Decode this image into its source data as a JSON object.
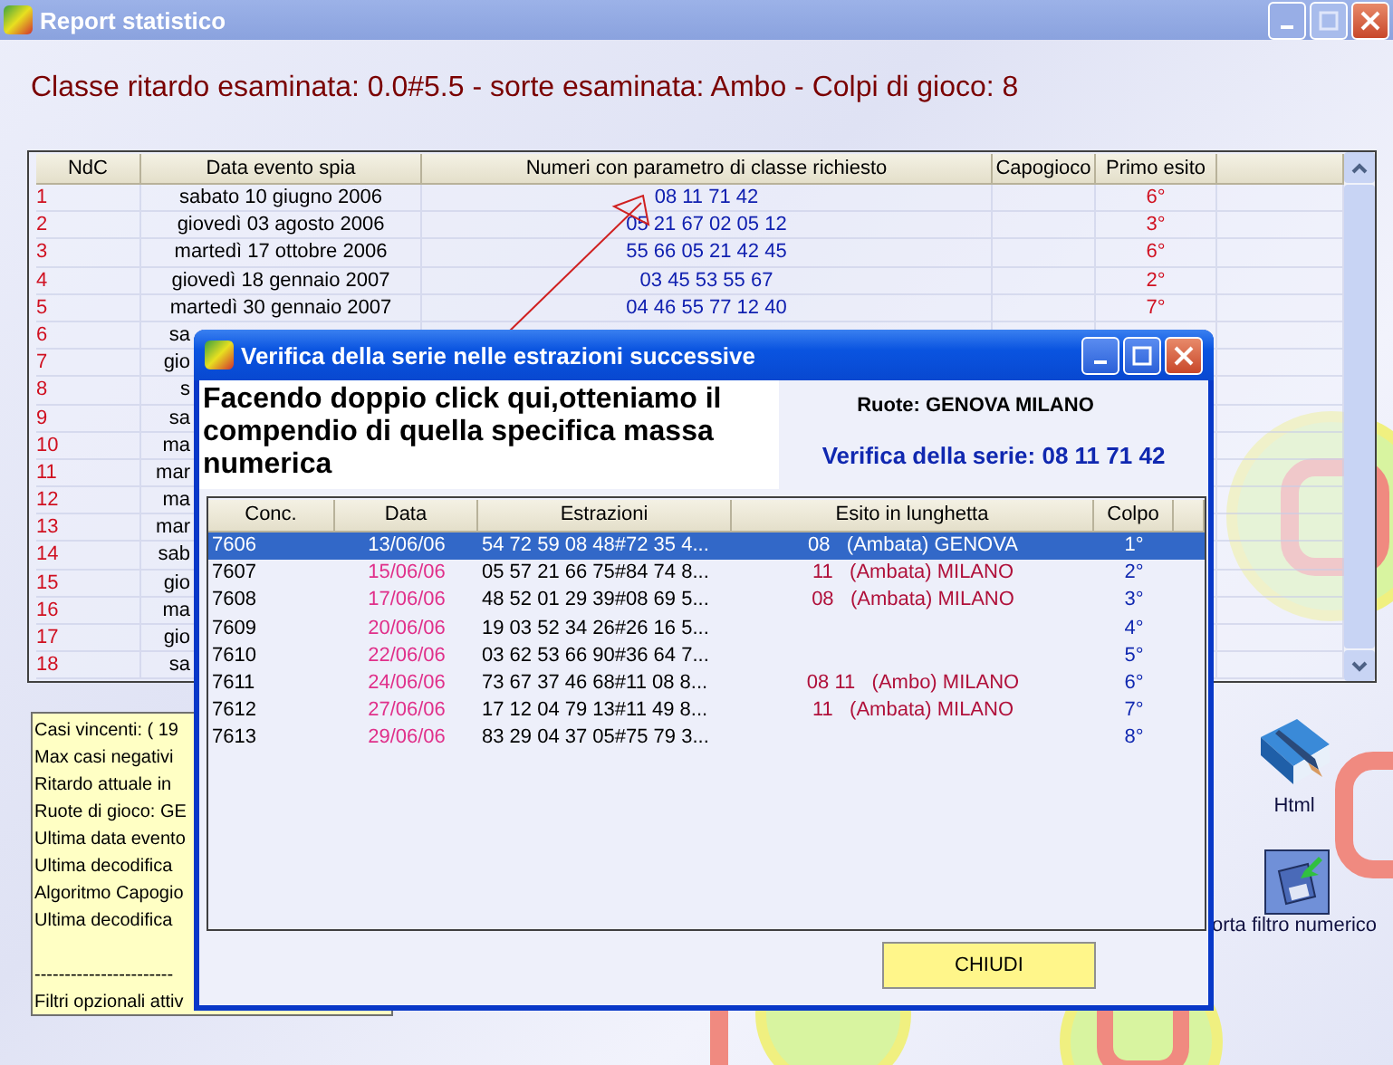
{
  "window": {
    "title": "Report statistico"
  },
  "heading": "Classe ritardo esaminata: 0.0#5.5 - sorte esaminata: Ambo - Colpi di gioco: 8",
  "report_table": {
    "columns": [
      "NdC",
      "Data evento spia",
      "Numeri con parametro di classe richiesto",
      "Capogioco",
      "Primo esito"
    ],
    "rows": [
      {
        "ndc": "1",
        "date": "sabato 10 giugno 2006",
        "numbers": "08 11 71 42",
        "primo_esito": "6°"
      },
      {
        "ndc": "2",
        "date": "giovedì 03 agosto 2006",
        "numbers": "05 21 67 02 05 12",
        "primo_esito": "3°"
      },
      {
        "ndc": "3",
        "date": "martedì 17 ottobre 2006",
        "numbers": "55 66 05 21 42 45",
        "primo_esito": "6°"
      },
      {
        "ndc": "4",
        "date": "giovedì 18 gennaio 2007",
        "numbers": "03 45 53 55 67",
        "primo_esito": "2°"
      },
      {
        "ndc": "5",
        "date": "martedì 30 gennaio 2007",
        "numbers": "04 46 55 77 12 40",
        "primo_esito": "7°"
      },
      {
        "ndc": "6",
        "date": "sa"
      },
      {
        "ndc": "7",
        "date": "gio"
      },
      {
        "ndc": "8",
        "date": "s"
      },
      {
        "ndc": "9",
        "date": "sa"
      },
      {
        "ndc": "10",
        "date": "ma"
      },
      {
        "ndc": "11",
        "date": "mar"
      },
      {
        "ndc": "12",
        "date": "ma"
      },
      {
        "ndc": "13",
        "date": "mar"
      },
      {
        "ndc": "14",
        "date": "sab"
      },
      {
        "ndc": "15",
        "date": "gio"
      },
      {
        "ndc": "16",
        "date": "ma"
      },
      {
        "ndc": "17",
        "date": "gio"
      },
      {
        "ndc": "18",
        "date": "sa"
      }
    ]
  },
  "summary_panel": {
    "lines": [
      "Casi vincenti: ( 19",
      "Max casi negativi",
      "Ritardo attuale in",
      "Ruote di gioco: GE",
      "Ultima data evento",
      "Ultima decodifica",
      "Algoritmo Capogio",
      "Ultima decodifica"
    ],
    "separator": "-----------------------",
    "filter_line": "Filtri opzionali attiv"
  },
  "side_buttons": [
    {
      "kind": "book",
      "label": "Html"
    },
    {
      "kind": "floppy",
      "label": "orta filtro numerico"
    }
  ],
  "dialog": {
    "title": "Verifica della serie nelle estrazioni successive",
    "note": "Facendo doppio click qui,otteniamo il compendio di quella specifica massa numerica",
    "wheels": "Ruote: GENOVA MILANO",
    "series": "Verifica della serie: 08 11 71 42",
    "columns": [
      "Conc.",
      "Data",
      "Estrazioni",
      "Esito in lunghetta",
      "Colpo"
    ],
    "rows": [
      {
        "conc": "7606",
        "date": "13/06/06",
        "draws": "54 72 59 08 48#72 35 4...",
        "esito_numbers": "08",
        "esito_detail": "(Ambata) GENOVA",
        "colpo": "1°",
        "selected": true
      },
      {
        "conc": "7607",
        "date": "15/06/06",
        "draws": "05 57 21 66 75#84 74 8...",
        "esito_numbers": "11",
        "esito_detail": "(Ambata) MILANO",
        "colpo": "2°",
        "selected": false
      },
      {
        "conc": "7608",
        "date": "17/06/06",
        "draws": "48 52 01 29 39#08 69 5...",
        "esito_numbers": "08",
        "esito_detail": "(Ambata) MILANO",
        "colpo": "3°",
        "selected": false
      },
      {
        "conc": "7609",
        "date": "20/06/06",
        "draws": "19 03 52 34 26#26 16 5...",
        "colpo": "4°",
        "selected": false
      },
      {
        "conc": "7610",
        "date": "22/06/06",
        "draws": "03 62 53 66 90#36 64 7...",
        "colpo": "5°",
        "selected": false
      },
      {
        "conc": "7611",
        "date": "24/06/06",
        "draws": "73 67 37 46 68#11 08 8...",
        "esito_numbers": "08 11",
        "esito_detail": "(Ambo) MILANO",
        "colpo": "6°",
        "selected": false
      },
      {
        "conc": "7612",
        "date": "27/06/06",
        "draws": "17 12 04 79 13#11 49 8...",
        "esito_numbers": "11",
        "esito_detail": "(Ambata) MILANO",
        "colpo": "7°",
        "selected": false
      },
      {
        "conc": "7613",
        "date": "29/06/06",
        "draws": "83 29 04 37 05#75 79 3...",
        "colpo": "8°",
        "selected": false
      }
    ],
    "close_button": "CHIUDI"
  }
}
